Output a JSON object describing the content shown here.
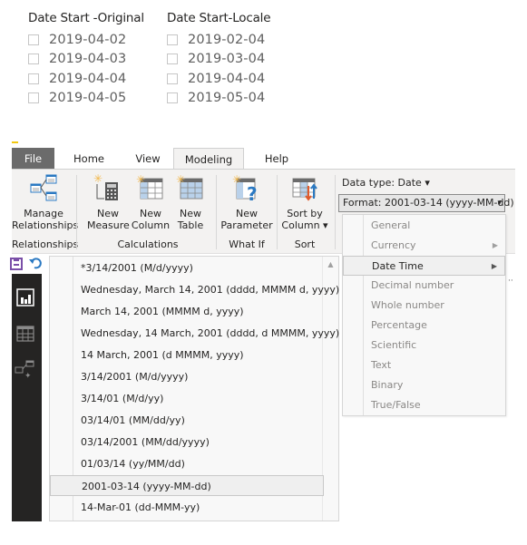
{
  "slicers": [
    {
      "title": "Date Start -Original",
      "items": [
        "2019-04-02",
        "2019-04-03",
        "2019-04-04",
        "2019-04-05"
      ]
    },
    {
      "title": "Date Start-Locale",
      "items": [
        "2019-02-04",
        "2019-03-04",
        "2019-04-04",
        "2019-05-04"
      ]
    }
  ],
  "ribbon": {
    "tabs": [
      {
        "label": "File"
      },
      {
        "label": "Home"
      },
      {
        "label": "View"
      },
      {
        "label": "Modeling",
        "active": true
      },
      {
        "label": "Help"
      }
    ],
    "buttons": {
      "manage_relationships": [
        "Manage",
        "Relationships"
      ],
      "new_measure": [
        "New",
        "Measure"
      ],
      "new_column": [
        "New",
        "Column"
      ],
      "new_table": [
        "New",
        "Table"
      ],
      "new_parameter": [
        "New",
        "Parameter"
      ],
      "sort_by_column": [
        "Sort by",
        "Column ▾"
      ]
    },
    "groups": {
      "relationships": "Relationships",
      "calculations": "Calculations",
      "what_if": "What If",
      "sort": "Sort"
    },
    "data_type_label": "Data type: Date ▾",
    "format_label": "Format: 2001-03-14 (yyyy-MM-dd)",
    "format_caret": "▾"
  },
  "format_list": {
    "items": [
      "*3/14/2001 (M/d/yyyy)",
      "Wednesday, March 14, 2001 (dddd, MMMM d, yyyy)",
      "March 14, 2001 (MMMM d, yyyy)",
      "Wednesday, 14 March, 2001 (dddd, d MMMM, yyyy)",
      "14 March, 2001 (d MMMM, yyyy)",
      "3/14/2001 (M/d/yyyy)",
      "3/14/01 (M/d/yy)",
      "03/14/01 (MM/dd/yy)",
      "03/14/2001 (MM/dd/yyyy)",
      "01/03/14 (yy/MM/dd)",
      "2001-03-14 (yyyy-MM-dd)",
      "14-Mar-01 (dd-MMM-yy)"
    ],
    "selected_index": 10,
    "scroll_up": "▲"
  },
  "format_categories": {
    "items": [
      {
        "label": "General",
        "submenu": false
      },
      {
        "label": "Currency",
        "submenu": true
      },
      {
        "label": "Date Time",
        "submenu": true,
        "active": true
      },
      {
        "label": "Decimal number",
        "submenu": false
      },
      {
        "label": "Whole number",
        "submenu": false
      },
      {
        "label": "Percentage",
        "submenu": false
      },
      {
        "label": "Scientific",
        "submenu": false
      },
      {
        "label": "Text",
        "submenu": false
      },
      {
        "label": "Binary",
        "submenu": false
      },
      {
        "label": "True/False",
        "submenu": false
      }
    ],
    "submenu_arrow": "▶"
  },
  "colors": {
    "accent_yellow": "#f2c811",
    "file_tab": "#6b6b6b",
    "dark_nav": "#252423",
    "save_purple": "#7a4fa8",
    "undo_blue": "#2b79c2"
  }
}
